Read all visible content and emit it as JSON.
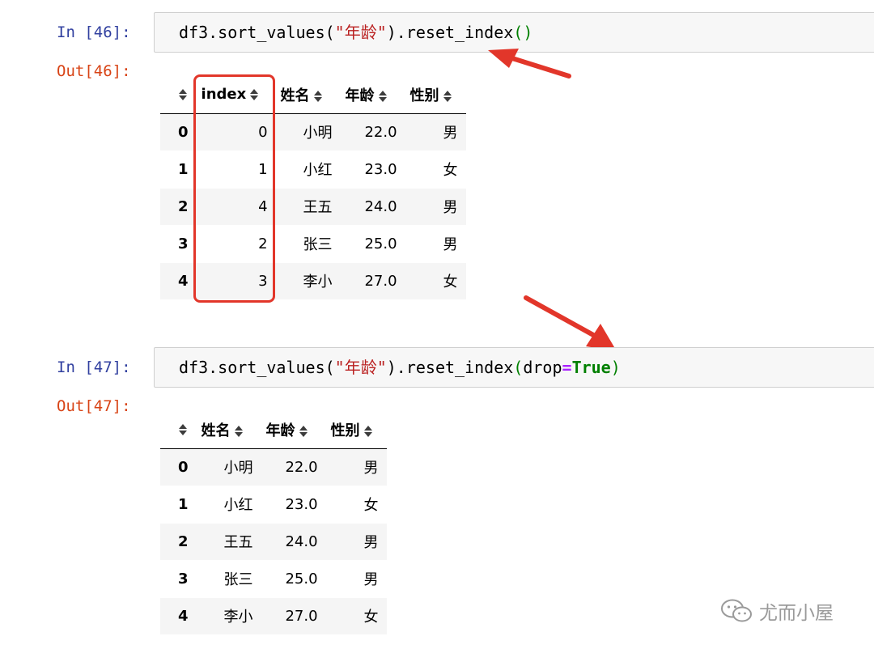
{
  "cells": [
    {
      "in_prompt": "In [46]:",
      "out_prompt": "Out[46]:",
      "code": {
        "p1": "df3.sort_values(",
        "str": "\"年龄\"",
        "p2": ").reset_index",
        "lparen": "(",
        "rparen": ")"
      },
      "table": {
        "columns": [
          "index",
          "姓名",
          "年龄",
          "性别"
        ],
        "rows": [
          [
            "0",
            "0",
            "小明",
            "22.0",
            "男"
          ],
          [
            "1",
            "1",
            "小红",
            "23.0",
            "女"
          ],
          [
            "2",
            "4",
            "王五",
            "24.0",
            "男"
          ],
          [
            "3",
            "2",
            "张三",
            "25.0",
            "男"
          ],
          [
            "4",
            "3",
            "李小",
            "27.0",
            "女"
          ]
        ]
      }
    },
    {
      "in_prompt": "In [47]:",
      "out_prompt": "Out[47]:",
      "code": {
        "p1": "df3.sort_values(",
        "str": "\"年龄\"",
        "p2": ").reset_index",
        "lparen": "(",
        "arg": "drop",
        "op": "=",
        "kw": "True",
        "rparen": ")"
      },
      "table": {
        "columns": [
          "姓名",
          "年龄",
          "性别"
        ],
        "rows": [
          [
            "0",
            "小明",
            "22.0",
            "男"
          ],
          [
            "1",
            "小红",
            "23.0",
            "女"
          ],
          [
            "2",
            "王五",
            "24.0",
            "男"
          ],
          [
            "3",
            "张三",
            "25.0",
            "男"
          ],
          [
            "4",
            "李小",
            "27.0",
            "女"
          ]
        ]
      }
    }
  ],
  "watermark": "尤而小屋",
  "colors": {
    "in_prompt": "#303f9f",
    "out_prompt": "#d84315",
    "string": "#ba2121",
    "keyword": "#008000",
    "operator": "#aa22ff",
    "annotation": "#e2362a"
  }
}
